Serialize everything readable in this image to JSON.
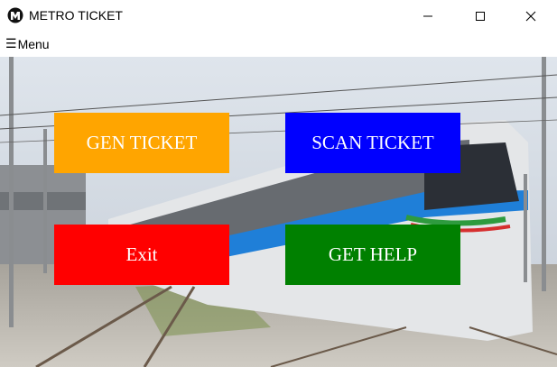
{
  "window": {
    "title": "METRO TICKET",
    "controls": [
      "minimize-icon",
      "maximize-icon",
      "close-icon"
    ]
  },
  "menubar": {
    "menu_glyph": "☰",
    "menu_label": "Menu"
  },
  "buttons": {
    "gen_ticket": {
      "label": "GEN TICKET",
      "color": "#FFA500"
    },
    "scan_ticket": {
      "label": "SCAN TICKET",
      "color": "#0000FF"
    },
    "exit": {
      "label": "Exit",
      "color": "#FF0000"
    },
    "get_help": {
      "label": "GET HELP",
      "color": "#008000"
    }
  },
  "background": {
    "subject": "metro train photo",
    "sky_color": "#cfd8e2",
    "train_body_color": "#e6e8ea",
    "train_accent_colors": [
      "#1f7fd8",
      "#2e9b3e",
      "#d62f2f"
    ]
  }
}
